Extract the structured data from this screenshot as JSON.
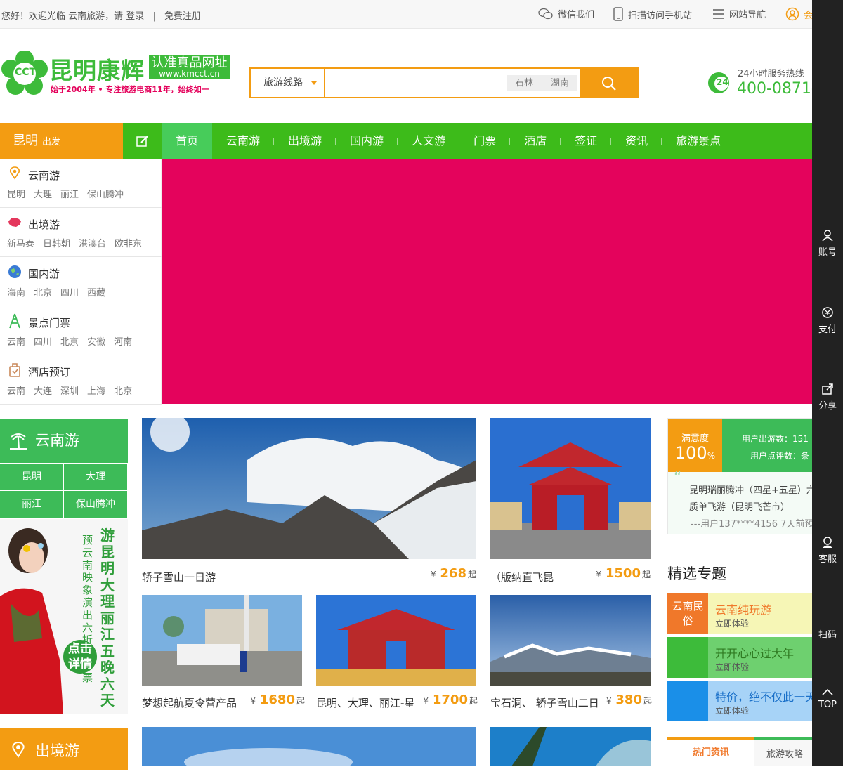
{
  "topbar": {
    "welcome": "您好！欢迎光临 云南旅游，请",
    "login": "登录",
    "sep": "|",
    "register": "免费注册",
    "wechat": "微信我们",
    "mobile": "扫描访问手机站",
    "sitenav": "网站导航",
    "member": "会"
  },
  "logo": {
    "name": "昆明康辉",
    "badge_text": "CCT",
    "slogan_box": "认准真品网址",
    "url": "www.kmcct.cn",
    "tagline": "始于2004年 • 专注旅游电商11年，始终如一"
  },
  "search": {
    "category": "旅游线路",
    "placeholder": "",
    "hot": [
      "石林",
      "湖南"
    ]
  },
  "hotline": {
    "label": "24小时服务热线",
    "number": "400-0871-",
    "icon_badge": "24"
  },
  "nav": {
    "city": "昆明",
    "city_suffix": "出发",
    "items": [
      "首页",
      "云南游",
      "出境游",
      "国内游",
      "人文游",
      "门票",
      "酒店",
      "签证",
      "资讯",
      "旅游景点"
    ]
  },
  "sidemenu": [
    {
      "title": "云南游",
      "subs": [
        "昆明",
        "大理",
        "丽江",
        "保山腾冲"
      ]
    },
    {
      "title": "出境游",
      "subs": [
        "新马泰",
        "日韩朝",
        "港澳台",
        "欧非东"
      ]
    },
    {
      "title": "国内游",
      "subs": [
        "海南",
        "北京",
        "四川",
        "西藏"
      ]
    },
    {
      "title": "景点门票",
      "subs": [
        "云南",
        "四川",
        "北京",
        "安徽",
        "河南"
      ]
    },
    {
      "title": "酒店预订",
      "subs": [
        "云南",
        "大连",
        "深圳",
        "上海",
        "北京"
      ]
    }
  ],
  "rightbar": [
    "账号",
    "支付",
    "分享",
    "客服",
    "扫码",
    "TOP"
  ],
  "yunnan": {
    "title": "云南游",
    "links": [
      "昆明",
      "大理",
      "丽江",
      "保山腾冲"
    ],
    "promo_big": "游昆明大理丽江五晚六天",
    "promo_small": "预云南映象演出六折优惠票",
    "promo_btn": "点击详情"
  },
  "chujing": {
    "title": "出境游"
  },
  "products": [
    {
      "title": "轿子雪山一日游",
      "currency": "¥",
      "price": "268",
      "suffix": "起"
    },
    {
      "title": "（版纳直飞昆",
      "currency": "¥",
      "price": "1500",
      "suffix": "起"
    },
    {
      "title": "梦想起航夏令营产品",
      "currency": "¥",
      "price": "1680",
      "suffix": "起"
    },
    {
      "title": "昆明、大理、丽江-星",
      "currency": "¥",
      "price": "1700",
      "suffix": "起"
    },
    {
      "title": "宝石洞、 轿子雪山二日",
      "currency": "¥",
      "price": "380",
      "suffix": "起"
    }
  ],
  "satisfaction": {
    "label": "满意度",
    "value": "100",
    "unit": "%",
    "stat1": "用户出游数：151",
    "stat2": "用户点评数：条",
    "review1": "昆明瑞丽腾冲（四星+五星）六",
    "review2": "质单飞游（昆明飞芒市）",
    "review_user": "---用户137****4156 7天前预"
  },
  "topics": {
    "title": "精选专题",
    "items": [
      {
        "tag": "云南民俗",
        "title": "云南纯玩游",
        "sub": "立即体验",
        "tag_color": "#f0782a",
        "bg": "#f6f6b6",
        "title_color": "#f0782a"
      },
      {
        "tag": "",
        "title": "开开心心过大年",
        "sub": "立即体验",
        "tag_color": "#3dbb3a",
        "bg": "#6ed06f",
        "title_color": "#2f7a21"
      },
      {
        "tag": "",
        "title": "特价，绝不仅此一天",
        "sub": "立即体验",
        "tag_color": "#1a8fe8",
        "bg": "#a7d3f7",
        "title_color": "#1a70c9"
      }
    ]
  },
  "newstabs": [
    "热门资讯",
    "旅游攻略"
  ],
  "colors": {
    "green": "#3dbb1a",
    "orange": "#f39c12",
    "banner": "#e4035c"
  }
}
